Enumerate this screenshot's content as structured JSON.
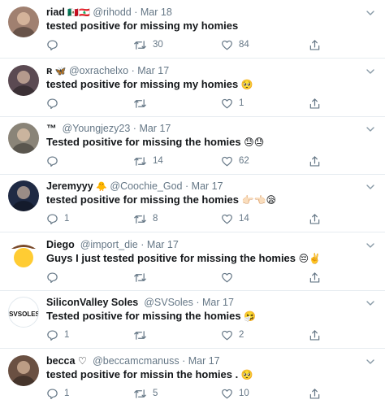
{
  "tweets": [
    {
      "name": "riad",
      "badge": "🇲🇽🇱🇧",
      "handle": "@rihodd",
      "dot": "·",
      "time": "Mar 18",
      "text": "tested positive for missing my homies",
      "emoji": "",
      "replies": "",
      "retweets": "30",
      "likes": "84",
      "avatar_color": "#a08070"
    },
    {
      "name": "ʀ",
      "badge": "🦋",
      "handle": "@oxrachelxo",
      "dot": "·",
      "time": "Mar 17",
      "text": "tested positive for missing my homies",
      "emoji": "🥺",
      "replies": "",
      "retweets": "",
      "likes": "1",
      "avatar_color": "#5b4a52"
    },
    {
      "name": "™",
      "badge": "",
      "handle": "@Youngjezy23",
      "dot": "·",
      "time": "Mar 17",
      "text": "Tested positive for missing the homies",
      "emoji": "😓😓",
      "replies": "",
      "retweets": "14",
      "likes": "62",
      "avatar_color": "#8a8478"
    },
    {
      "name": "Jeremyyy",
      "badge": "🐥",
      "handle": "@Coochie_God",
      "dot": "·",
      "time": "Mar 17",
      "text": "tested positive for missing the homies",
      "emoji": "👉🏻👈🏻😪",
      "replies": "1",
      "retweets": "8",
      "likes": "14",
      "avatar_color": "#1f2a44"
    },
    {
      "name": "Diego",
      "badge": "",
      "handle": "@import_die",
      "dot": "·",
      "time": "Mar 17",
      "text": "Guys I just tested positive for missing the homies",
      "emoji": "😔✌️",
      "replies": "",
      "retweets": "",
      "likes": "",
      "avatar_color": "#ffcc33"
    },
    {
      "name": "SiliconValley Soles",
      "badge": "",
      "handle": "@SVSoles",
      "dot": "·",
      "time": "Mar 17",
      "text": "Tested positive for missing the homies",
      "emoji": "🤧",
      "replies": "1",
      "retweets": "",
      "likes": "2",
      "avatar_color": "#ffffff",
      "avatar_text": "SVSOLES"
    },
    {
      "name": "becca ♡",
      "badge": "",
      "handle": "@beccamcmanuss",
      "dot": "·",
      "time": "Mar 17",
      "text": "tested positive for missin the homies .",
      "emoji": "🥺",
      "replies": "1",
      "retweets": "5",
      "likes": "10",
      "avatar_color": "#6a5042"
    }
  ]
}
